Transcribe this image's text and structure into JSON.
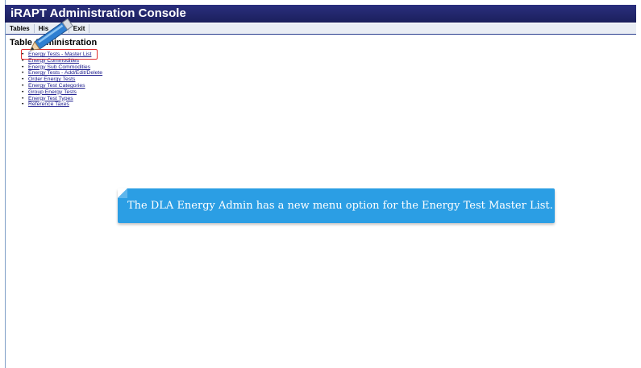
{
  "app": {
    "title": "iRAPT Administration Console"
  },
  "menubar": {
    "items": [
      {
        "label": "Tables"
      },
      {
        "label": "His"
      },
      {
        "label": "Exit"
      }
    ]
  },
  "section": {
    "title": "Table Administration"
  },
  "links": [
    {
      "label": "Energy Tests - Master List"
    },
    {
      "label": "Energy Commodities"
    },
    {
      "label": "Energy Sub Commodities"
    },
    {
      "label": "Energy Tests - Add/Edit/Delete"
    },
    {
      "label": "Order Energy Tests"
    },
    {
      "label": "Energy Test Categories"
    },
    {
      "label": "Group Energy Tests"
    },
    {
      "label": "Energy Test Types"
    },
    {
      "label": "Reference Taxes"
    }
  ],
  "callout": {
    "text": "The DLA Energy Admin has a new menu option for the Energy Test Master List."
  },
  "colors": {
    "titlebar": "#1f2368",
    "highlight": "#e23030",
    "callout": "#2b9ee4"
  },
  "icons": {
    "pencil": "pencil-icon"
  }
}
